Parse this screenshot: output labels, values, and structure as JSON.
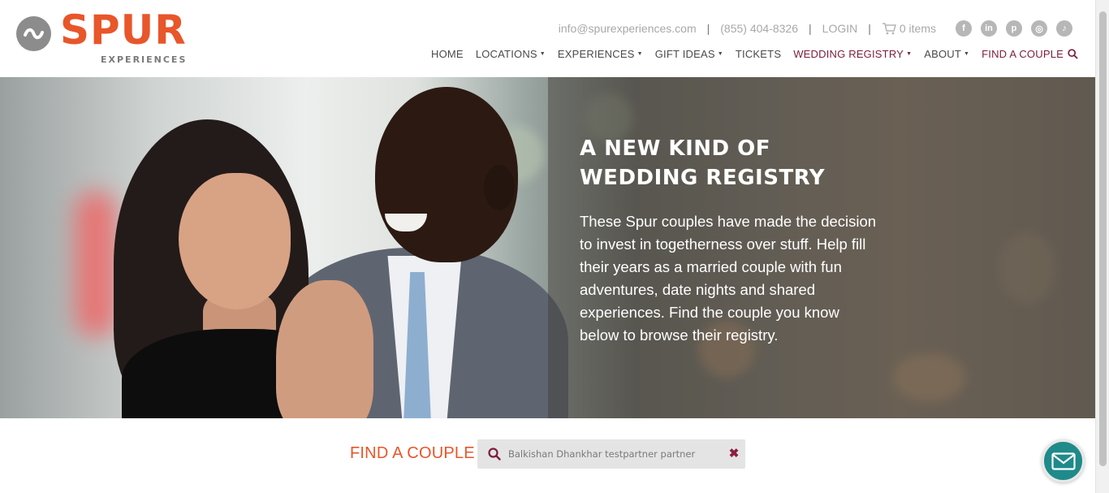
{
  "brand": {
    "name": "SPUR",
    "subtitle": "EXPERIENCES",
    "accent": "#e8562a",
    "registry_color": "#7d1c3c"
  },
  "topbar": {
    "email": "info@spurexperiences.com",
    "phone": "(855) 404-8326",
    "login": "LOGIN",
    "cart": "0 items",
    "cart_icon": "cart-icon",
    "socials": [
      {
        "icon": "facebook-icon",
        "glyph": "f"
      },
      {
        "icon": "linkedin-icon",
        "glyph": "in"
      },
      {
        "icon": "pinterest-icon",
        "glyph": "p"
      },
      {
        "icon": "instagram-icon",
        "glyph": "◎"
      },
      {
        "icon": "tiktok-icon",
        "glyph": "♪"
      }
    ]
  },
  "nav": {
    "home": "HOME",
    "locations": "LOCATIONS",
    "experiences": "EXPERIENCES",
    "gift_ideas": "GIFT IDEAS",
    "tickets": "TICKETS",
    "wedding_registry": "WEDDING REGISTRY",
    "about": "ABOUT",
    "find_couple": "FIND A COUPLE"
  },
  "hero": {
    "title_line1": "A NEW KIND OF",
    "title_line2": "WEDDING REGISTRY",
    "body": "These Spur couples have made the decision to invest in togetherness over stuff. Help fill their years as a married couple with fun adventures, date nights and shared experiences. Find the couple you know below to browse their registry."
  },
  "find_couple": {
    "label": "FIND A COUPLE",
    "search_value": "Balkishan Dhankhar testpartner partner",
    "clear_icon": "close-icon"
  },
  "chat": {
    "icon": "mail-icon"
  }
}
